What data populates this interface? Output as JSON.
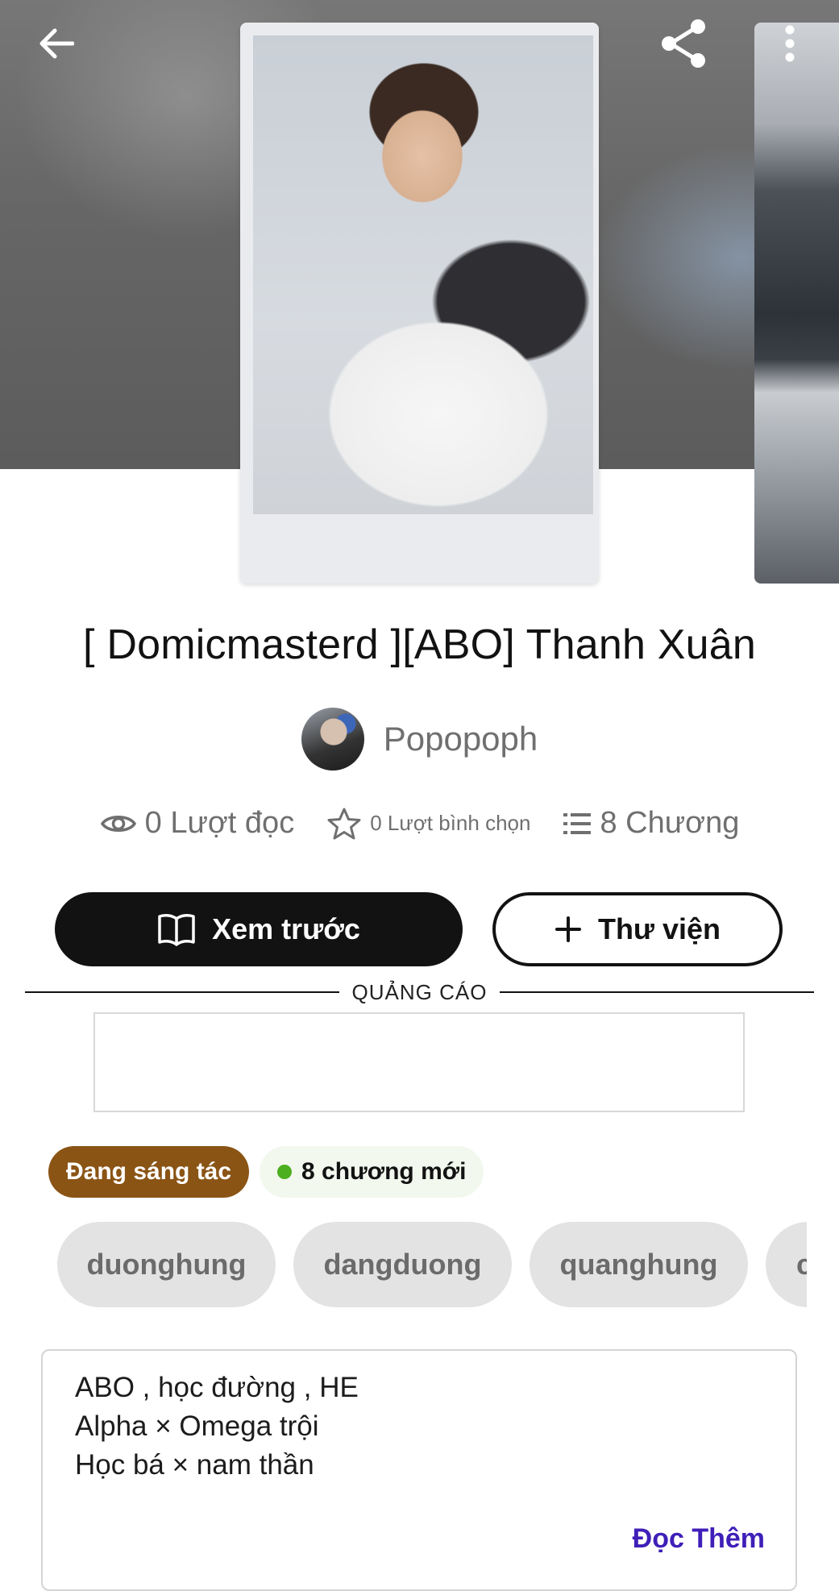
{
  "header": {
    "back_icon": "arrow-left-icon",
    "share_icon": "share-icon",
    "more_icon": "more-vertical-icon"
  },
  "story": {
    "title": "[ Domicmasterd ][ABO] Thanh Xuân",
    "author": "Popopoph"
  },
  "stats": {
    "reads": "0 Lượt đọc",
    "votes": "0 Lượt bình chọn",
    "chapters": "8 Chương"
  },
  "actions": {
    "preview_label": "Xem trước",
    "library_label": "Thư viện"
  },
  "ad": {
    "label": "QUẢNG CÁO"
  },
  "status": {
    "ongoing": "Đang sáng tác",
    "new_chapters": "8 chương mới",
    "new_dot_color": "#4caf1e",
    "ongoing_color": "#8a5415"
  },
  "tags": [
    "duonghung",
    "dangduong",
    "quanghung",
    "c"
  ],
  "description": {
    "lines": [
      "ABO , học đường , HE",
      "Alpha × Omega trội",
      "Học bá × nam thần"
    ],
    "read_more": "Đọc Thêm"
  }
}
